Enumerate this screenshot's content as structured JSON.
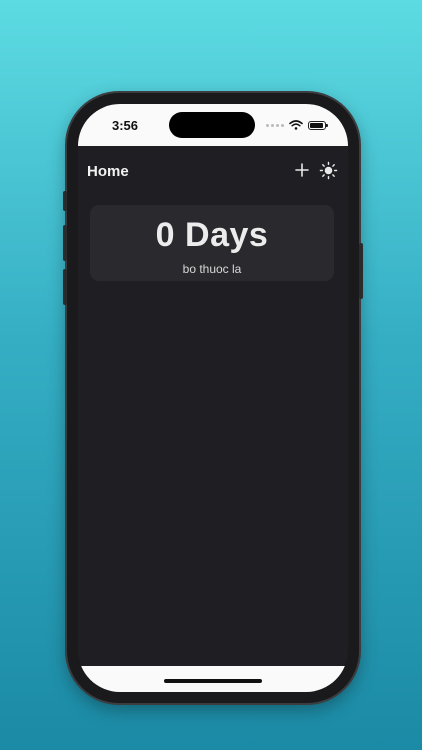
{
  "status_bar": {
    "time": "3:56",
    "battery_level": 0.9
  },
  "nav": {
    "title": "Home",
    "add_icon": "plus-icon",
    "theme_icon": "sun-icon"
  },
  "counter_card": {
    "count_text": "0 Days",
    "label": "bo thuoc la"
  },
  "colors": {
    "screen_background": "#1f1e22",
    "card_background": "#2a292e",
    "text_primary": "#ececec",
    "background_gradient_top": "#5ddbe2",
    "background_gradient_bottom": "#1b8aa5"
  }
}
